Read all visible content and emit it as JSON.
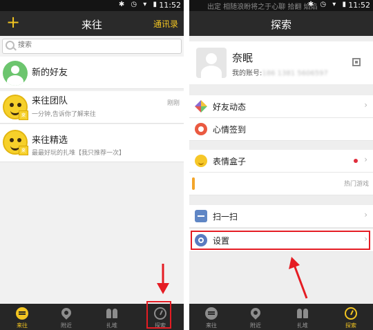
{
  "left_screen": {
    "status_bar": {
      "time": "11:52"
    },
    "title_bar": {
      "add_icon_glyph": "+",
      "title": "来往",
      "contacts_link": "通讯录"
    },
    "search": {
      "placeholder": "搜索"
    },
    "list": [
      {
        "name": "新的好友",
        "subtitle": "",
        "time": ""
      },
      {
        "name": "来往团队",
        "subtitle": "一分钟,告诉你了解来往",
        "time": "刚刚"
      },
      {
        "name": "来往精选",
        "subtitle": "最最好玩的扎堆【我只推荐一次】",
        "time": ""
      }
    ],
    "tabs": [
      {
        "label": "来往",
        "icon": "chat-bubble-icon",
        "active": true
      },
      {
        "label": "附近",
        "icon": "location-pin-icon",
        "active": false
      },
      {
        "label": "扎堆",
        "icon": "group-icon",
        "active": false
      },
      {
        "label": "探索",
        "icon": "compass-icon",
        "active": false
      }
    ]
  },
  "right_screen": {
    "status_bar": {
      "notice": "出定  相随浪盼将之于心聊  拾翻  焰焰",
      "time": "11:52"
    },
    "title_bar": {
      "title": "探索"
    },
    "profile": {
      "name": "奈眠",
      "account_label": "我的账号:",
      "account_value": "186 1381 5606597"
    },
    "menu": [
      {
        "label": "好友动态",
        "icon": "pinwheel-icon"
      },
      {
        "label": "心情签到",
        "icon": "mood-icon"
      },
      {
        "label": "表情盒子",
        "icon": "smiley-icon",
        "badge": true
      },
      {
        "label": "",
        "icon": "game-icon",
        "trailing": "热门游戏"
      },
      {
        "label": "扫一扫",
        "icon": "scan-icon"
      },
      {
        "label": "设置",
        "icon": "gear-icon"
      }
    ],
    "tabs": [
      {
        "label": "来往",
        "icon": "chat-bubble-icon",
        "active": false
      },
      {
        "label": "附近",
        "icon": "location-pin-icon",
        "active": false
      },
      {
        "label": "扎堆",
        "icon": "group-icon",
        "active": false
      },
      {
        "label": "探索",
        "icon": "compass-icon",
        "active": true
      }
    ]
  },
  "colors": {
    "accent": "#f3c521",
    "highlight": "#e51c23",
    "title_bar": "#2a2a2a"
  }
}
